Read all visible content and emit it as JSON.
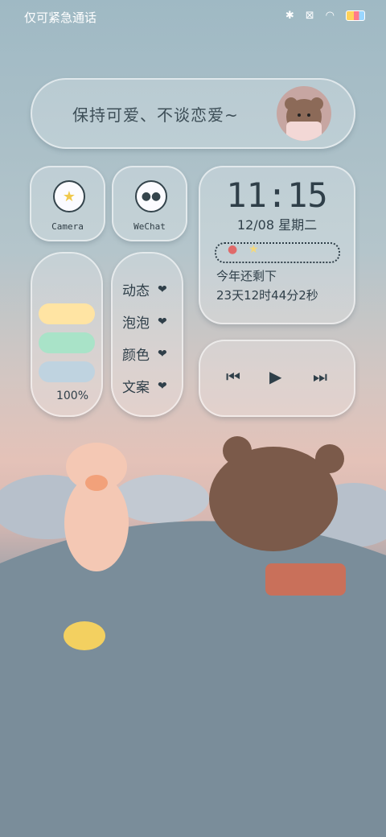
{
  "status_bar": {
    "carrier": "仅可紧急通话"
  },
  "slogan": {
    "text": "保持可爱、不谈恋爱~"
  },
  "apps": [
    {
      "label": "Camera"
    },
    {
      "label": "WeChat"
    }
  ],
  "clock": {
    "time": "11:15",
    "date": "12/08  星期二",
    "remain_label": "今年还剩下",
    "remain_value": "23天12时44分2秒"
  },
  "sliders": {
    "colors": [
      "#ffe4a3",
      "#a9e3c8",
      "#bfd3e0"
    ],
    "percent": "100%"
  },
  "menu": {
    "items": [
      "动态",
      "泡泡",
      "颜色",
      "文案"
    ]
  },
  "music": {
    "prev": "⏮",
    "play": "▶",
    "next": "⏭"
  }
}
